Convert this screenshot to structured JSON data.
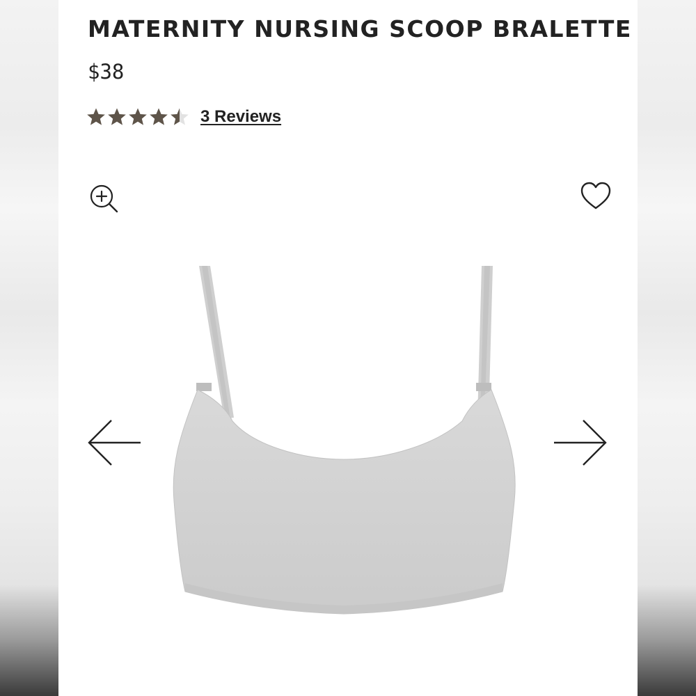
{
  "product": {
    "title": "MATERNITY NURSING SCOOP BRALETTE",
    "price": "$38",
    "rating": {
      "value": 4.5,
      "max": 5,
      "reviews_label": "3 Reviews"
    },
    "image": {
      "description_icon": "gray-bralette-photo",
      "fabric_color": "#d3d3d3"
    }
  },
  "icons": {
    "zoom": "zoom-in-icon",
    "favorite": "heart-icon",
    "previous": "arrow-left-icon",
    "next": "arrow-right-icon"
  },
  "colors": {
    "text": "#222222",
    "star_filled": "#5e5449",
    "star_empty": "#e2e2e2",
    "background": "#ffffff"
  }
}
